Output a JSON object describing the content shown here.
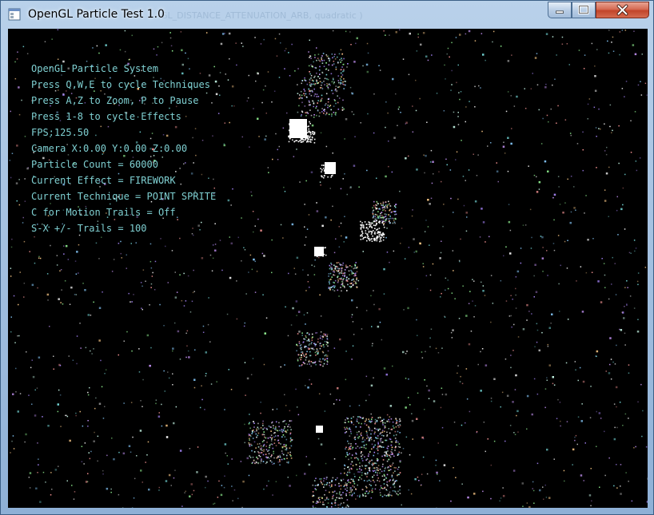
{
  "window": {
    "title": "OpenGL Particle Test 1.0",
    "ghost_text": "GL_DISTANCE_ATTENUATION_ARB, quadratic )"
  },
  "controls": {
    "minimize": "minimize-icon",
    "maximize": "maximize-icon",
    "close": "close-icon"
  },
  "hud": {
    "lines": [
      "OpenGL Particle System",
      "Press Q,W,E to cycle Techniques",
      "Press A,Z to Zoom, P to Pause",
      "Press 1-8 to cycle Effects",
      "FPS:125.50",
      "Camera X:0.00 Y:0.00 Z:0.00",
      "Particle Count = 60000",
      "Current Effect = FIREWORK",
      "Current Technique = POINT SPRITE",
      "C for Motion Trails = Off",
      "S-X +/- Trails = 100"
    ]
  },
  "colors": {
    "hud_text": "#7fd0d2",
    "background": "#000000",
    "close_button": "#c94a32"
  }
}
